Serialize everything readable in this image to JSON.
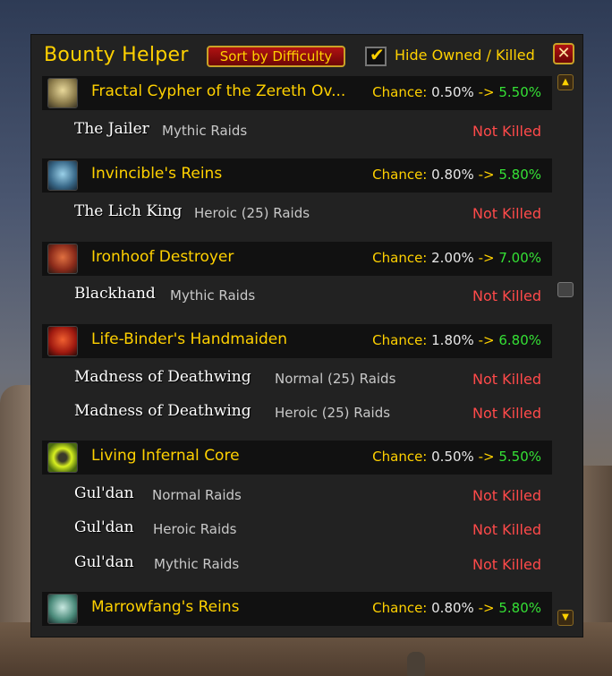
{
  "window": {
    "title": "Bounty Helper",
    "sort_label": "Sort by Difficulty",
    "hide_label": "Hide Owned / Killed",
    "hide_checked": true,
    "close_label": "✕"
  },
  "colors": {
    "gold": "#ffd100",
    "green": "#35e035",
    "red": "#ff4a4a"
  },
  "chance_label": "Chance:",
  "arrow": "->",
  "mounts": [
    {
      "name": "Fractal Cypher of the Zereth Ov...",
      "icon": "cypher-icon",
      "chance_from": "0.50%",
      "chance_to": "5.50%",
      "bosses": [
        {
          "name": "The Jailer",
          "difficulty": "Mythic Raids",
          "status": "Not Killed"
        }
      ]
    },
    {
      "name": "Invincible's Reins",
      "icon": "invincible-icon",
      "chance_from": "0.80%",
      "chance_to": "5.80%",
      "bosses": [
        {
          "name": "The Lich King",
          "difficulty": "Heroic (25) Raids",
          "status": "Not Killed"
        }
      ]
    },
    {
      "name": "Ironhoof Destroyer",
      "icon": "ironhoof-icon",
      "chance_from": "2.00%",
      "chance_to": "7.00%",
      "bosses": [
        {
          "name": "Blackhand",
          "difficulty": "Mythic Raids",
          "status": "Not Killed"
        }
      ]
    },
    {
      "name": "Life-Binder's Handmaiden",
      "icon": "drake-icon",
      "chance_from": "1.80%",
      "chance_to": "6.80%",
      "bosses": [
        {
          "name": "Madness of Deathwing",
          "difficulty": "Normal (25) Raids",
          "status": "Not Killed"
        },
        {
          "name": "Madness of Deathwing",
          "difficulty": "Heroic (25) Raids",
          "status": "Not Killed"
        }
      ]
    },
    {
      "name": "Living Infernal Core",
      "icon": "infernal-core-icon",
      "chance_from": "0.50%",
      "chance_to": "5.50%",
      "bosses": [
        {
          "name": "Gul'dan",
          "difficulty": "Normal Raids",
          "status": "Not Killed"
        },
        {
          "name": "Gul'dan",
          "difficulty": "Heroic Raids",
          "status": "Not Killed"
        },
        {
          "name": "Gul'dan",
          "difficulty": "Mythic Raids",
          "status": "Not Killed"
        }
      ]
    },
    {
      "name": "Marrowfang's Reins",
      "icon": "marrowfang-icon",
      "chance_from": "0.80%",
      "chance_to": "5.80%",
      "bosses": []
    }
  ]
}
